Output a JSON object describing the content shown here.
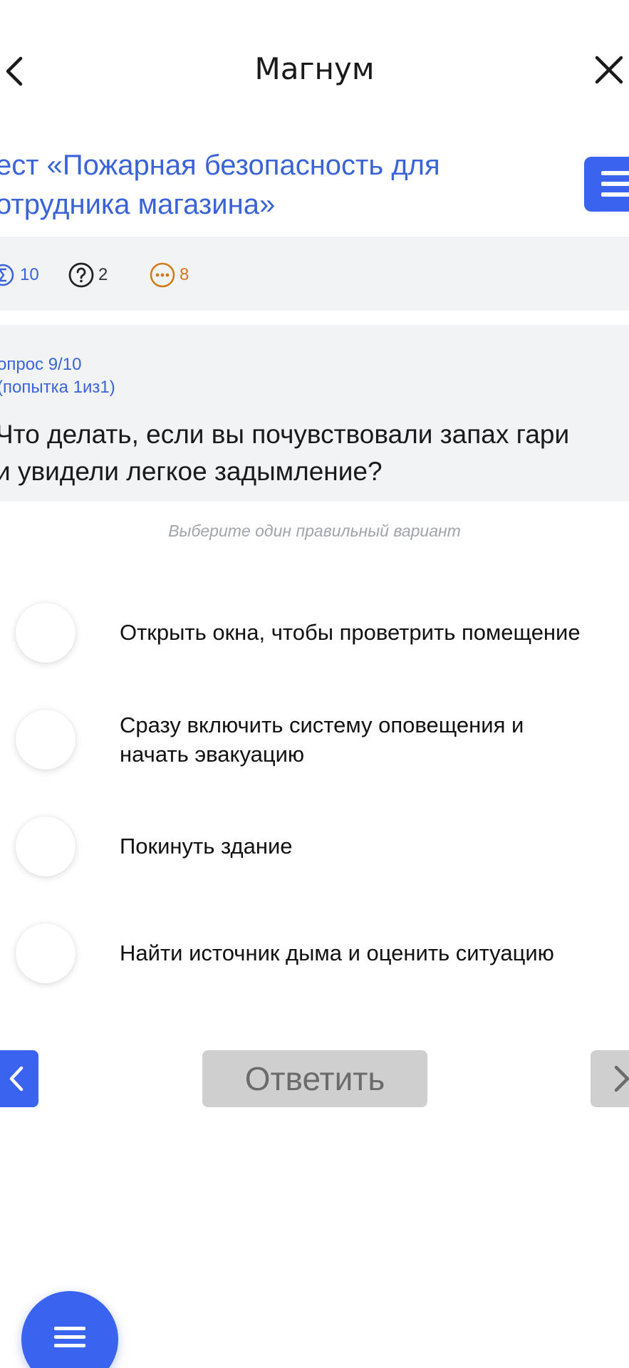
{
  "header": {
    "title": "Магнум",
    "back_icon": "chevron-left-icon",
    "close_icon": "close-icon"
  },
  "test": {
    "title": "ест «Пожарная безопасность для\nотрудника магазина»",
    "menu_icon": "menu-icon"
  },
  "stats": {
    "total": "10",
    "unanswered": "2",
    "remaining": "8",
    "total_icon": "sigma-icon",
    "unanswered_icon": "question-circle-icon",
    "remaining_icon": "ellipsis-circle-icon",
    "total_color": "#3a63d8",
    "unanswered_color": "#333333",
    "remaining_color": "#d07a1a"
  },
  "question": {
    "number": "опрос 9/10",
    "attempt": "(попытка 1из1)",
    "text": "Что делать, если вы почувствовали запах гари\nи увидели легкое задымление?"
  },
  "hint": "Выберите один правильный вариант",
  "options": [
    {
      "label": "Открыть окна, чтобы проветрить помещение"
    },
    {
      "label": "Сразу включить систему оповещения и\nначать эвакуацию"
    },
    {
      "label": "Покинуть здание"
    },
    {
      "label": "Найти источник дыма и оценить ситуацию"
    }
  ],
  "nav": {
    "answer_label": "Ответить",
    "prev_icon": "chevron-left-icon",
    "next_icon": "chevron-right-icon"
  },
  "fab": {
    "icon": "menu-icon"
  },
  "colors": {
    "accent": "#3a63f0",
    "title_blue": "#3a63d8",
    "panel_bg": "#f2f3f5",
    "disabled_btn": "#cfcfcf"
  }
}
